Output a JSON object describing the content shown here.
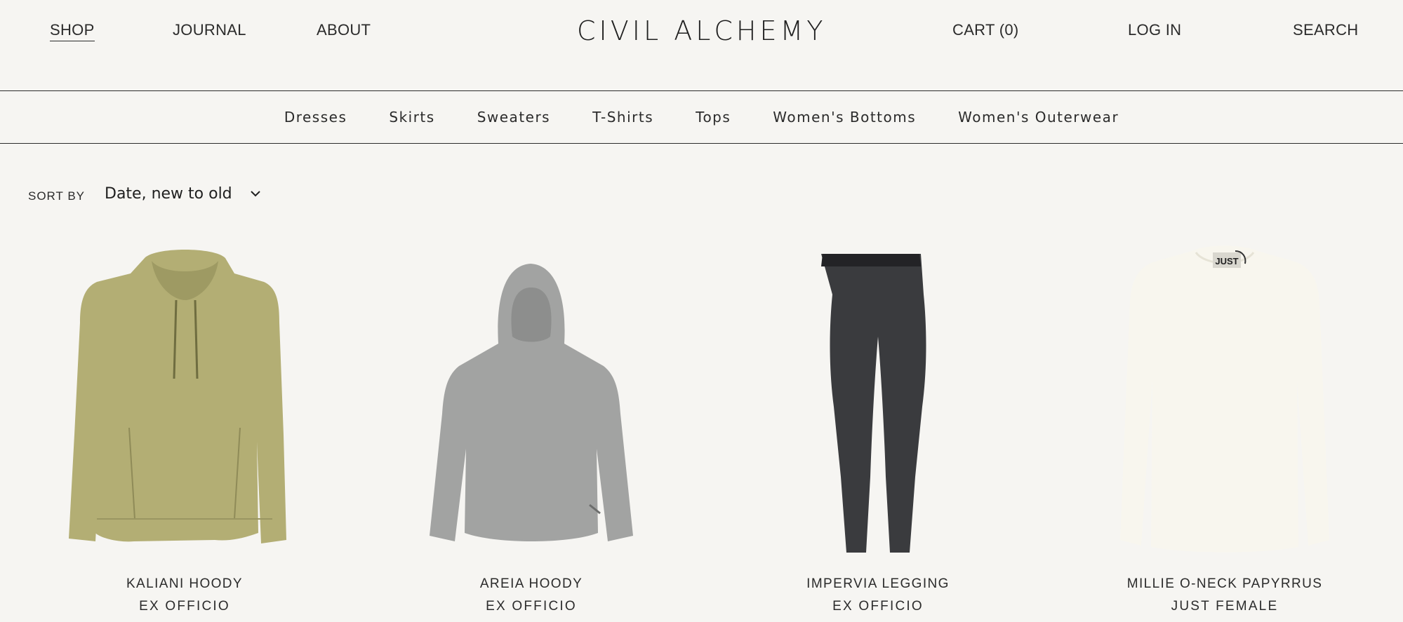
{
  "header": {
    "nav": {
      "shop": "SHOP",
      "journal": "JOURNAL",
      "about": "ABOUT",
      "cart": "CART (0)",
      "login": "LOG IN",
      "search": "SEARCH"
    },
    "logo": "CIVIL ALCHEMY"
  },
  "categories": [
    "Dresses",
    "Skirts",
    "Sweaters",
    "T-Shirts",
    "Tops",
    "Women's Bottoms",
    "Women's Outerwear"
  ],
  "sort": {
    "label": "SORT BY",
    "value": "Date, new to old"
  },
  "products": [
    {
      "name": "KALIANI HOODY",
      "brand": "EX OFFICIO",
      "color": "#b3ae74"
    },
    {
      "name": "AREIA HOODY",
      "brand": "EX OFFICIO",
      "color": "#a2a3a2"
    },
    {
      "name": "IMPERVIA LEGGING",
      "brand": "EX OFFICIO",
      "color": "#3a3b3e"
    },
    {
      "name": "MILLIE O-NECK PAPYRRUS",
      "brand": "JUST FEMALE",
      "color": "#f8f6ee",
      "tag_text": "JUST"
    }
  ]
}
